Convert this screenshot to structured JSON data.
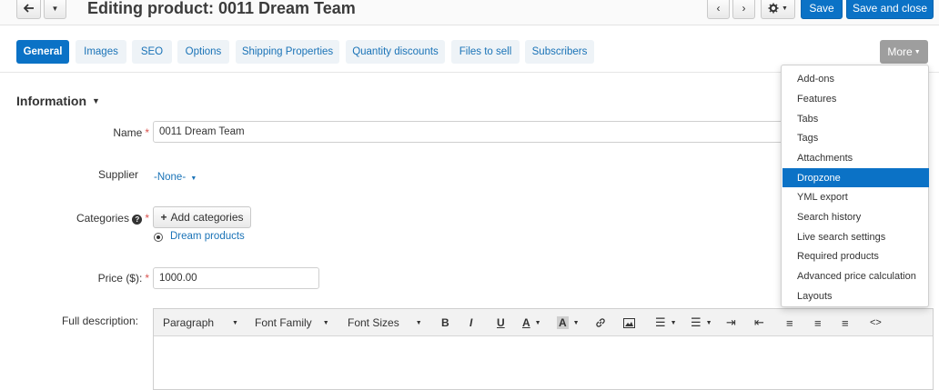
{
  "header": {
    "title": "Editing product: 0011 Dream Team",
    "back_icon": "arrow-left-icon",
    "save_label": "Save",
    "save_close_label": "Save and close"
  },
  "tabs": [
    {
      "label": "General",
      "active": true
    },
    {
      "label": "Images"
    },
    {
      "label": "SEO"
    },
    {
      "label": "Options"
    },
    {
      "label": "Shipping Properties"
    },
    {
      "label": "Quantity discounts"
    },
    {
      "label": "Files to sell"
    },
    {
      "label": "Subscribers"
    }
  ],
  "more_label": "More",
  "more_menu": [
    {
      "label": "Add-ons"
    },
    {
      "label": "Features"
    },
    {
      "label": "Tabs"
    },
    {
      "label": "Tags"
    },
    {
      "label": "Attachments"
    },
    {
      "label": "Dropzone",
      "active": true
    },
    {
      "label": "YML export"
    },
    {
      "label": "Search history"
    },
    {
      "label": "Live search settings"
    },
    {
      "label": "Required products"
    },
    {
      "label": "Advanced price calculation"
    },
    {
      "label": "Layouts"
    }
  ],
  "section": {
    "title": "Information"
  },
  "form": {
    "name_label": "Name",
    "name_value": "0011 Dream Team",
    "supplier_label": "Supplier",
    "supplier_value": "-None-",
    "categories_label": "Categories",
    "add_categories_label": "Add categories",
    "category_value": "Dream products",
    "price_label": "Price ($):",
    "price_value": "1000.00",
    "description_label": "Full description:"
  },
  "editor": {
    "paragraph": "Paragraph",
    "font_family": "Font Family",
    "font_sizes": "Font Sizes"
  },
  "colors": {
    "accent": "#0b72c6",
    "tab_bg": "#eef3f7",
    "required": "#d9534f"
  }
}
